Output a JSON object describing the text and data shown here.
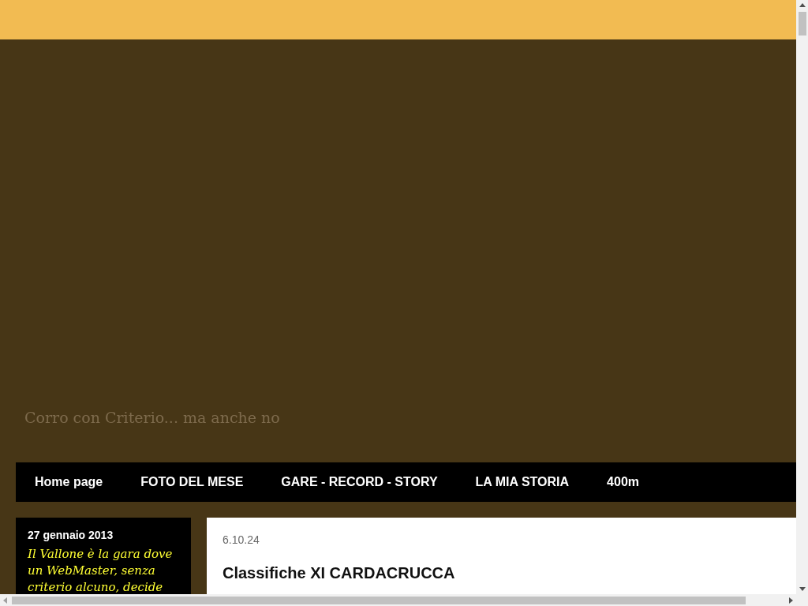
{
  "header": {
    "tagline": "Corro con Criterio... ma anche no"
  },
  "nav": {
    "items": [
      {
        "label": "Home page"
      },
      {
        "label": "FOTO DEL MESE"
      },
      {
        "label": "GARE - RECORD - STORY"
      },
      {
        "label": "LA MIA STORIA"
      },
      {
        "label": "400m"
      }
    ]
  },
  "sidebar": {
    "date": "27 gennaio 2013",
    "text": "Il Vallone è la gara dove un WebMaster, senza criterio alcuno, decide"
  },
  "post": {
    "date": "6.10.24",
    "title": "Classifiche XI CARDACRUCCA"
  }
}
